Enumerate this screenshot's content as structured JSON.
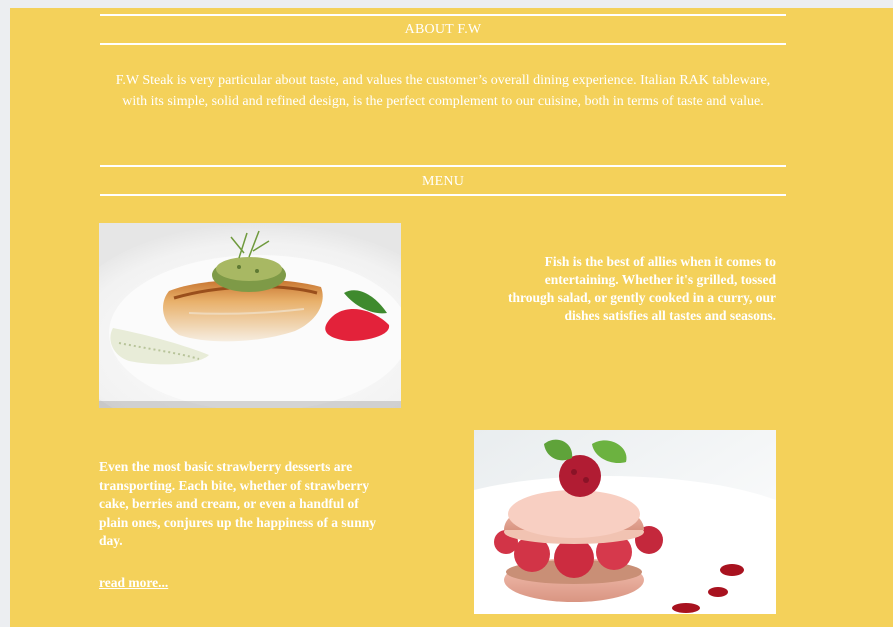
{
  "about": {
    "heading": "ABOUT F.W",
    "text": "F.W Steak is very particular about taste, and values the customer’s overall dining experience. Italian RAK tableware, with its simple, solid and refined design, is the perfect complement to our cuisine, both in terms of taste and value."
  },
  "menu": {
    "heading": "MENU",
    "items": [
      {
        "image": "grilled-fish-dish",
        "caption": "Fish is the best of allies when it comes to entertaining. Whether it's grilled, tossed through salad, or gently cooked in a curry, our dishes satisfies all tastes and seasons."
      },
      {
        "image": "strawberry-macaron-dessert",
        "caption": "Even the most basic strawberry desserts are transporting. Each bite, whether of strawberry cake, berries and cream, or even a handful of plain ones, conjures up the happiness of a sunny day."
      }
    ],
    "read_more": "read more..."
  },
  "colors": {
    "page_background": "#f4d15a",
    "outer_background": "#eceef1",
    "text": "#ffffff"
  }
}
